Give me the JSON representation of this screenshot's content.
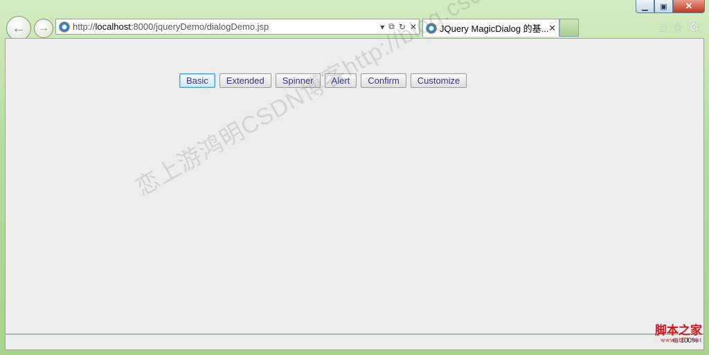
{
  "window": {
    "minimize": "▁",
    "maximize": "▣",
    "close": "✕"
  },
  "nav": {
    "back_icon": "arrow-left-icon",
    "forward_icon": "arrow-right-icon",
    "back_glyph": "←",
    "forward_glyph": "→"
  },
  "address": {
    "url_prefix": "http://",
    "url_host": "localhost",
    "url_rest": ":8000/jqueryDemo/dialogDemo.jsp",
    "dropdown": "▾",
    "compat": "⧉",
    "refresh": "↻",
    "stop": "✕"
  },
  "tab": {
    "title": "JQuery MagicDialog 的基...",
    "close": "✕"
  },
  "toolbar": {
    "home": "⌂",
    "favorites": "☆",
    "tools": "⚙"
  },
  "page": {
    "buttons": [
      {
        "label": "Basic"
      },
      {
        "label": "Extended"
      },
      {
        "label": "Spinner"
      },
      {
        "label": "Alert"
      },
      {
        "label": "Confirm"
      },
      {
        "label": "Customize"
      }
    ],
    "watermark": "恋上游鸿明CSDN博客http://blog.csdn.net/youqishini"
  },
  "status": {
    "zoom_icon": "magnifier-icon",
    "zoom_glyph": "⊕",
    "zoom_level": "100%"
  },
  "logo": {
    "main": "脚本之家",
    "sub": "www.jb51.net"
  },
  "colors": {
    "frame": "#b7dc9e",
    "content_bg": "#eeedee",
    "button_text": "#37358a",
    "focus": "#4a9fd6",
    "logo_red": "#d4141c"
  }
}
